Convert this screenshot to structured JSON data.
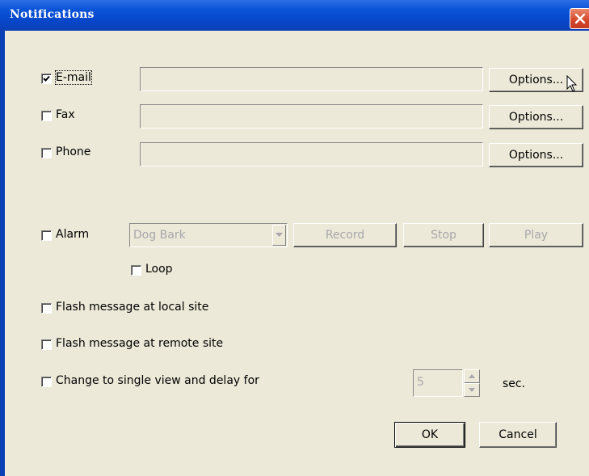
{
  "window": {
    "title": "Notifications"
  },
  "contacts": [
    {
      "label": "E-mail",
      "checked": true,
      "value": "",
      "options_label": "Options..."
    },
    {
      "label": "Fax",
      "checked": false,
      "value": "",
      "options_label": "Options..."
    },
    {
      "label": "Phone",
      "checked": false,
      "value": "",
      "options_label": "Options..."
    }
  ],
  "alarm": {
    "label": "Alarm",
    "checked": false,
    "sound": "Dog Bark",
    "record_label": "Record",
    "stop_label": "Stop",
    "play_label": "Play",
    "loop_label": "Loop",
    "loop_checked": false
  },
  "flash_local": {
    "label": "Flash message at local site",
    "checked": false
  },
  "flash_remote": {
    "label": "Flash message at remote site",
    "checked": false
  },
  "single_view": {
    "label": "Change to single view and delay for",
    "checked": false,
    "delay": "5",
    "unit": "sec."
  },
  "buttons": {
    "ok": "OK",
    "cancel": "Cancel"
  },
  "colors": {
    "titlebar": "#0a54d8",
    "dialog_bg": "#ece9d8",
    "close_button": "#d6452b"
  }
}
